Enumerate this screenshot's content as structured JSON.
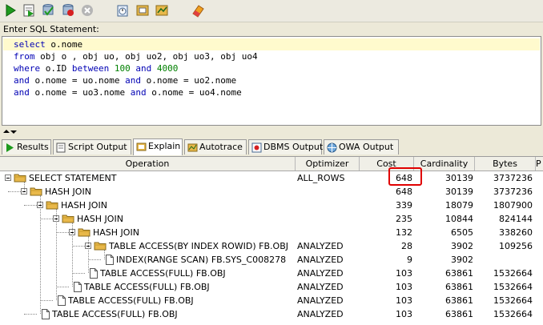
{
  "sql_panel": {
    "label": "Enter SQL Statement:",
    "lines": [
      [
        {
          "t": "select",
          "k": "kw"
        },
        {
          "t": " o.nome"
        }
      ],
      [
        {
          "t": "from",
          "k": "kw"
        },
        {
          "t": " obj o , obj uo, obj uo2, obj uo3, obj uo4"
        }
      ],
      [
        {
          "t": "where",
          "k": "kw"
        },
        {
          "t": " o.ID "
        },
        {
          "t": "between",
          "k": "kw"
        },
        {
          "t": " "
        },
        {
          "t": "100",
          "k": "num"
        },
        {
          "t": " "
        },
        {
          "t": "and",
          "k": "kw"
        },
        {
          "t": " "
        },
        {
          "t": "4000",
          "k": "num"
        }
      ],
      [
        {
          "t": "and",
          "k": "kw"
        },
        {
          "t": " o.nome = uo.nome "
        },
        {
          "t": "and",
          "k": "kw"
        },
        {
          "t": " o.nome = uo2.nome"
        }
      ],
      [
        {
          "t": "and",
          "k": "kw"
        },
        {
          "t": " o.nome = uo3.nome "
        },
        {
          "t": "and",
          "k": "kw"
        },
        {
          "t": " o.nome = uo4.nome"
        }
      ]
    ]
  },
  "tabs": [
    {
      "label": "Results",
      "icon": "run-icon"
    },
    {
      "label": "Script Output",
      "icon": "script-icon"
    },
    {
      "label": "Explain",
      "icon": "explain-icon",
      "active": true
    },
    {
      "label": "Autotrace",
      "icon": "autotrace-icon"
    },
    {
      "label": "DBMS Output",
      "icon": "dbms-icon"
    },
    {
      "label": "OWA Output",
      "icon": "owa-icon"
    }
  ],
  "columns": {
    "operation": "Operation",
    "optimizer": "Optimizer",
    "cost": "Cost",
    "cardinality": "Cardinality",
    "bytes": "Bytes",
    "extra": "P"
  },
  "rows": [
    {
      "level": 0,
      "type": "folder",
      "op": "SELECT STATEMENT",
      "optimizer": "ALL_ROWS",
      "cost": "648",
      "card": "30139",
      "bytes": "3737236"
    },
    {
      "level": 1,
      "type": "folder",
      "op": "HASH JOIN",
      "optimizer": "",
      "cost": "648",
      "card": "30139",
      "bytes": "3737236"
    },
    {
      "level": 2,
      "type": "folder",
      "op": "HASH JOIN",
      "optimizer": "",
      "cost": "339",
      "card": "18079",
      "bytes": "1807900"
    },
    {
      "level": 3,
      "type": "folder",
      "op": "HASH JOIN",
      "optimizer": "",
      "cost": "235",
      "card": "10844",
      "bytes": "824144"
    },
    {
      "level": 4,
      "type": "folder",
      "op": "HASH JOIN",
      "optimizer": "",
      "cost": "132",
      "card": "6505",
      "bytes": "338260"
    },
    {
      "level": 5,
      "type": "folder",
      "op": "TABLE ACCESS(BY INDEX ROWID) FB.OBJ",
      "optimizer": "ANALYZED",
      "cost": "28",
      "card": "3902",
      "bytes": "109256"
    },
    {
      "level": 6,
      "type": "doc",
      "op": "INDEX(RANGE SCAN) FB.SYS_C008278",
      "optimizer": "ANALYZED",
      "cost": "9",
      "card": "3902",
      "bytes": ""
    },
    {
      "level": 5,
      "type": "doc",
      "op": "TABLE ACCESS(FULL) FB.OBJ",
      "optimizer": "ANALYZED",
      "cost": "103",
      "card": "63861",
      "bytes": "1532664"
    },
    {
      "level": 4,
      "type": "doc",
      "op": "TABLE ACCESS(FULL) FB.OBJ",
      "optimizer": "ANALYZED",
      "cost": "103",
      "card": "63861",
      "bytes": "1532664"
    },
    {
      "level": 3,
      "type": "doc",
      "op": "TABLE ACCESS(FULL) FB.OBJ",
      "optimizer": "ANALYZED",
      "cost": "103",
      "card": "63861",
      "bytes": "1532664"
    },
    {
      "level": 2,
      "type": "doc",
      "op": "TABLE ACCESS(FULL) FB.OBJ",
      "optimizer": "ANALYZED",
      "cost": "103",
      "card": "63861",
      "bytes": "1532664"
    }
  ],
  "colors": {
    "folder": "#e8b84a",
    "keyword": "#0000b4",
    "number": "#008000",
    "highlight": "#e00000"
  }
}
